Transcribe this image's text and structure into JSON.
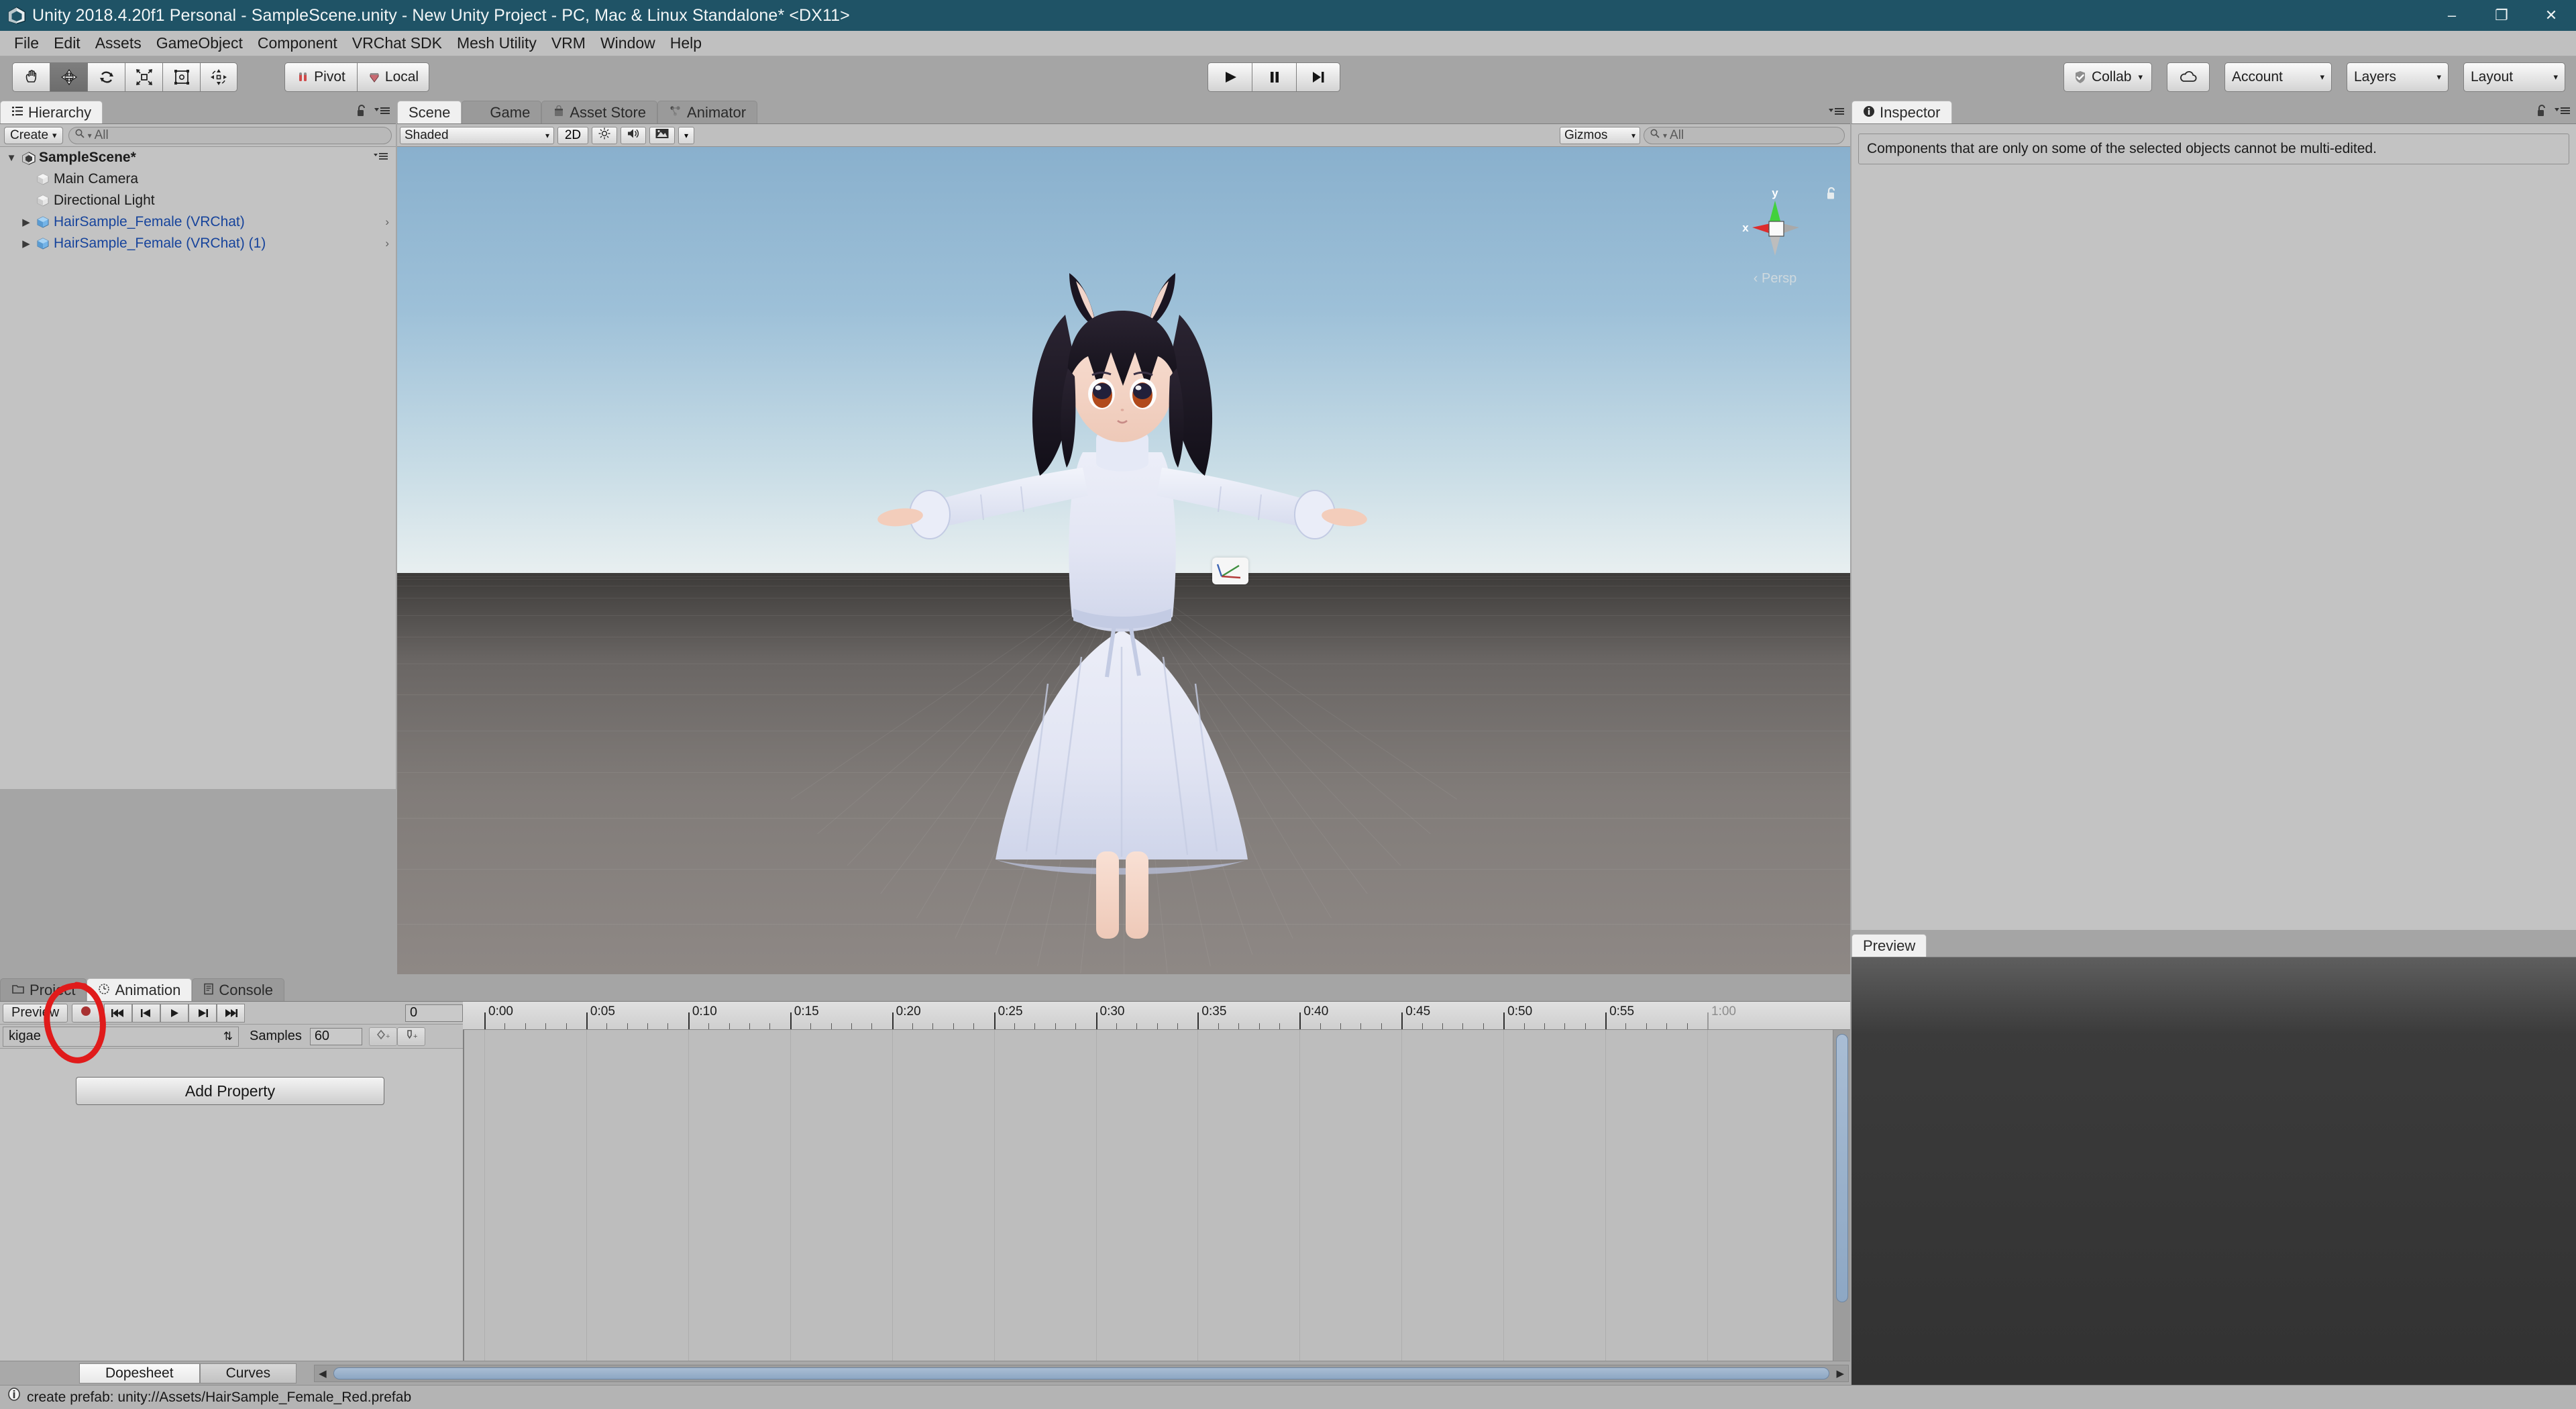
{
  "window": {
    "title": "Unity 2018.4.20f1 Personal - SampleScene.unity - New Unity Project - PC, Mac & Linux Standalone* <DX11>",
    "logo_icon": "unity-logo-icon",
    "minimize_label": "–",
    "maximize_label": "❐",
    "close_label": "✕",
    "titlebar_color": "#1f5366"
  },
  "menubar": {
    "items": [
      {
        "label": "File"
      },
      {
        "label": "Edit"
      },
      {
        "label": "Assets"
      },
      {
        "label": "GameObject"
      },
      {
        "label": "Component"
      },
      {
        "label": "VRChat SDK"
      },
      {
        "label": "Mesh Utility"
      },
      {
        "label": "VRM"
      },
      {
        "label": "Window"
      },
      {
        "label": "Help"
      }
    ]
  },
  "toolbar": {
    "transform_tools": [
      {
        "name": "hand-tool",
        "icon": "hand-icon",
        "active": false
      },
      {
        "name": "move-tool",
        "icon": "move-arrows-icon",
        "active": true
      },
      {
        "name": "rotate-tool",
        "icon": "rotate-icon",
        "active": false
      },
      {
        "name": "scale-tool",
        "icon": "scale-icon",
        "active": false
      },
      {
        "name": "rect-tool",
        "icon": "rect-transform-icon",
        "active": false
      },
      {
        "name": "transform-tool",
        "icon": "combined-transform-icon",
        "active": false
      }
    ],
    "pivot_label": "Pivot",
    "pivot_icon": "pivot-icon",
    "space_label": "Local",
    "space_icon": "local-space-icon",
    "play_label": "▶",
    "pause_label": "❙❙",
    "step_label": "▶❙",
    "collab_label": "Collab",
    "collab_icon": "collab-check-icon",
    "cloud_icon": "cloud-icon",
    "account_label": "Account",
    "layers_label": "Layers",
    "layout_label": "Layout",
    "dropdown_arrow": "▾"
  },
  "hierarchy": {
    "tab_label": "Hierarchy",
    "tab_icon": "hierarchy-icon",
    "lock_icon": "lock-open-icon",
    "menu_icon": "panel-menu-icon",
    "create_label": "Create",
    "search_placeholder": "All",
    "search_icon": "search-icon",
    "items": [
      {
        "label": "SampleScene*",
        "icon": "unity-scene-icon",
        "depth": 0,
        "expanded": true,
        "is_scene": true,
        "prefab": false,
        "has_chevron": false
      },
      {
        "label": "Main Camera",
        "icon": "gameobject-cube-icon",
        "depth": 1,
        "expanded": false,
        "is_scene": false,
        "prefab": false,
        "has_chevron": false
      },
      {
        "label": "Directional Light",
        "icon": "gameobject-cube-icon",
        "depth": 1,
        "expanded": false,
        "is_scene": false,
        "prefab": false,
        "has_chevron": false
      },
      {
        "label": "HairSample_Female (VRChat)",
        "icon": "prefab-cube-icon",
        "depth": 1,
        "expanded": false,
        "is_scene": false,
        "prefab": true,
        "has_chevron": true
      },
      {
        "label": "HairSample_Female (VRChat) (1)",
        "icon": "prefab-cube-icon",
        "depth": 1,
        "expanded": false,
        "is_scene": false,
        "prefab": true,
        "has_chevron": true
      }
    ]
  },
  "scene_panel": {
    "tabs": [
      {
        "label": "Scene",
        "icon": "scene-icon",
        "active": true
      },
      {
        "label": "Game",
        "icon": "game-icon",
        "active": false
      },
      {
        "label": "Asset Store",
        "icon": "asset-store-icon",
        "active": false
      },
      {
        "label": "Animator",
        "icon": "animator-icon",
        "active": false
      }
    ],
    "menu_icon": "panel-menu-icon",
    "shading_mode": "Shaded",
    "mode_2d_label": "2D",
    "lighting_icon": "sun-icon",
    "audio_icon": "speaker-icon",
    "effects_icon": "image-effects-icon",
    "gizmos_label": "Gizmos",
    "gizmos_search_placeholder": "All",
    "search_icon": "search-icon",
    "dropdown_arrow": "▾",
    "axis_x_label": "x",
    "axis_y_label": "y",
    "projection_label": "Persp",
    "projection_arrow": "‹",
    "lock_icon": "lock-open-icon",
    "sky_color": "#9dc0d8",
    "ground_color": "#817c79"
  },
  "inspector": {
    "tab_label": "Inspector",
    "tab_icon": "inspector-info-icon",
    "lock_icon": "lock-open-icon",
    "menu_icon": "panel-menu-icon",
    "message": "Components that are only on some of the selected objects cannot be multi-edited."
  },
  "preview": {
    "tab_label": "Preview",
    "background_color": "#323232"
  },
  "animation": {
    "tabs": [
      {
        "label": "Project",
        "icon": "folder-icon",
        "active": false
      },
      {
        "label": "Animation",
        "icon": "clock-icon",
        "active": true
      },
      {
        "label": "Console",
        "icon": "console-icon",
        "active": false
      }
    ],
    "preview_label": "Preview",
    "record_icon": "record-dot-icon",
    "record_color": "#a83232",
    "first_frame_label": "⏮",
    "prev_key_label": "⏴❙",
    "play_label": "▶",
    "next_key_label": "❙⏵",
    "last_frame_label": "⏭",
    "frame_value": "0",
    "clip_name": "kigae",
    "clip_arrow": "⇅",
    "samples_label": "Samples",
    "samples_value": "60",
    "add_keyframe_icon": "add-keyframe-icon",
    "add_event_icon": "add-event-icon",
    "add_property_label": "Add Property",
    "timeline_ticks": [
      {
        "label": "0:00",
        "seconds": 0
      },
      {
        "label": "0:05",
        "seconds": 5
      },
      {
        "label": "0:10",
        "seconds": 10
      },
      {
        "label": "0:15",
        "seconds": 15
      },
      {
        "label": "0:20",
        "seconds": 20
      },
      {
        "label": "0:25",
        "seconds": 25
      },
      {
        "label": "0:30",
        "seconds": 30
      },
      {
        "label": "0:35",
        "seconds": 35
      },
      {
        "label": "0:40",
        "seconds": 40
      },
      {
        "label": "0:45",
        "seconds": 45
      },
      {
        "label": "0:50",
        "seconds": 50
      },
      {
        "label": "0:55",
        "seconds": 55
      },
      {
        "label": "1:00",
        "seconds": 60,
        "dim": true
      }
    ],
    "bottom_tabs": [
      {
        "label": "Dopesheet",
        "active": true
      },
      {
        "label": "Curves",
        "active": false
      }
    ],
    "scroll_left_arrow": "◀",
    "scroll_right_arrow": "▶"
  },
  "statusbar": {
    "icon": "info-icon",
    "message": "create prefab: unity://Assets/HairSample_Female_Red.prefab"
  },
  "annotation": {
    "shape": "hand-drawn-red-circle",
    "color": "#e01b1b",
    "target": "animation-record-button"
  }
}
